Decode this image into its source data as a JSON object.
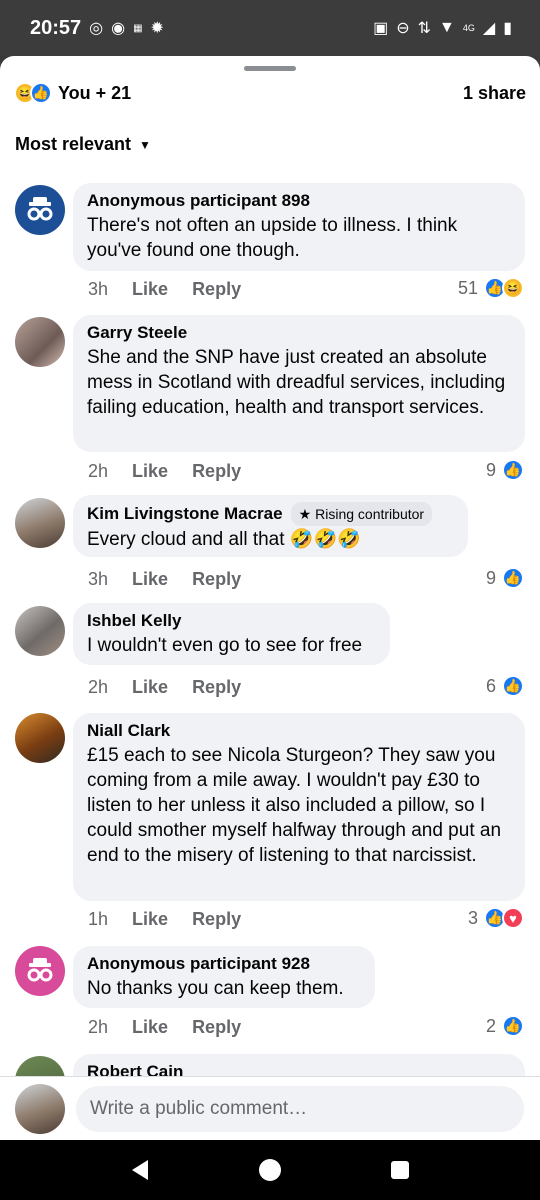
{
  "status_bar": {
    "time": "20:57",
    "icons_left": [
      "whatsapp-icon",
      "messenger-icon",
      "temu-icon",
      "settings-icon"
    ],
    "icons_right": [
      "nfc-icon",
      "do-not-disturb-icon",
      "data-arrows-icon",
      "wifi-icon",
      "4g-icon",
      "signal-icon",
      "battery-icon"
    ],
    "network_label": "4G"
  },
  "reactions": {
    "summary": "You + 21",
    "shares": "1 share",
    "types": [
      "haha",
      "like"
    ]
  },
  "sort": {
    "label": "Most relevant"
  },
  "actions": {
    "like": "Like",
    "reply": "Reply"
  },
  "comments": [
    {
      "author": "Anonymous participant 898",
      "text": "There's not often an upside to illness. I think you've found one though.",
      "time": "3h",
      "reaction_count": "51",
      "reaction_types": [
        "like",
        "haha"
      ],
      "avatar": "anonymous-avatar-blue"
    },
    {
      "author": "Garry Steele",
      "text": "She and the SNP have just created an absolute mess in Scotland with dreadful services, including failing education, health and transport services.",
      "time": "2h",
      "reaction_count": "9",
      "reaction_types": [
        "like"
      ],
      "avatar": "photo-avatar"
    },
    {
      "author": "Kim Livingstone Macrae",
      "badge": "Rising contributor",
      "text": "Every cloud and all that 🤣🤣🤣",
      "time": "3h",
      "reaction_count": "9",
      "reaction_types": [
        "like"
      ],
      "avatar": "photo-avatar"
    },
    {
      "author": "Ishbel Kelly",
      "text": "I wouldn't even go to see for free",
      "time": "2h",
      "reaction_count": "6",
      "reaction_types": [
        "like"
      ],
      "avatar": "photo-avatar"
    },
    {
      "author": "Niall Clark",
      "text": "£15 each to see Nicola Sturgeon? They saw you coming from a mile away. I wouldn't pay £30 to listen to her unless it also included a pillow, so I could smother myself halfway through and put an end to the misery of listening to that narcissist.",
      "time": "1h",
      "reaction_count": "3",
      "reaction_types": [
        "like",
        "love"
      ],
      "avatar": "photo-avatar"
    },
    {
      "author": "Anonymous participant 928",
      "text": "No thanks  you can keep them.",
      "time": "2h",
      "reaction_count": "2",
      "reaction_types": [
        "like"
      ],
      "avatar": "anonymous-avatar-pink"
    },
    {
      "author": "Robert Cain",
      "avatar": "photo-avatar"
    }
  ],
  "composer": {
    "placeholder": "Write a public comment…"
  },
  "nav": {
    "icons": [
      "back-icon",
      "home-icon",
      "recents-icon"
    ]
  }
}
